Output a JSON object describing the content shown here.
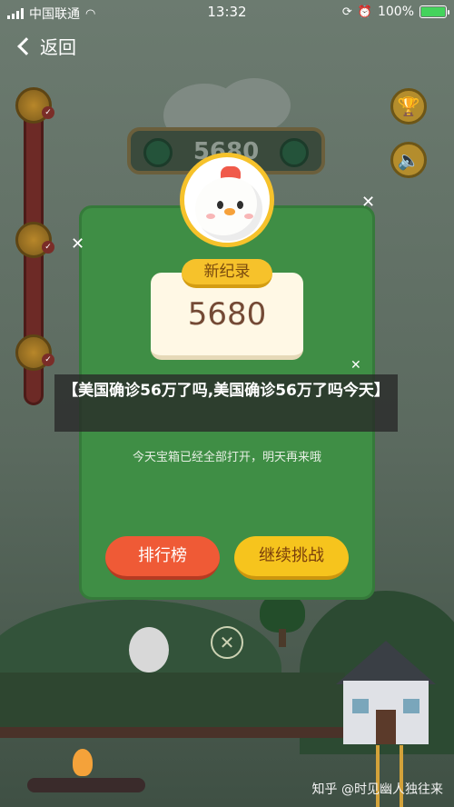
{
  "status_bar": {
    "carrier": "中国联通",
    "time": "13:32",
    "battery": "100%",
    "battery_level": 1.0,
    "battery_color": "#44d35c"
  },
  "nav": {
    "back_label": "返回"
  },
  "background": {
    "score_banner_value": "5680",
    "side_icons": [
      "trophy-icon",
      "speaker-icon"
    ]
  },
  "modal": {
    "record_label": "新纪录",
    "record_value": "5680",
    "note": "今天宝箱已经全部打开，明天再来哦",
    "rank_button": "排行榜",
    "continue_button": "继续挑战",
    "close_symbol": "✕"
  },
  "headline": "【美国确诊56万了吗,美国确诊56万了吗今天】",
  "watermark": "知乎 @时见幽人独往来",
  "colors": {
    "card_green": "#3f8e45",
    "rank_button": "#ef5a36",
    "continue_button": "#f6c41d",
    "record_tag": "#f6c22b"
  }
}
